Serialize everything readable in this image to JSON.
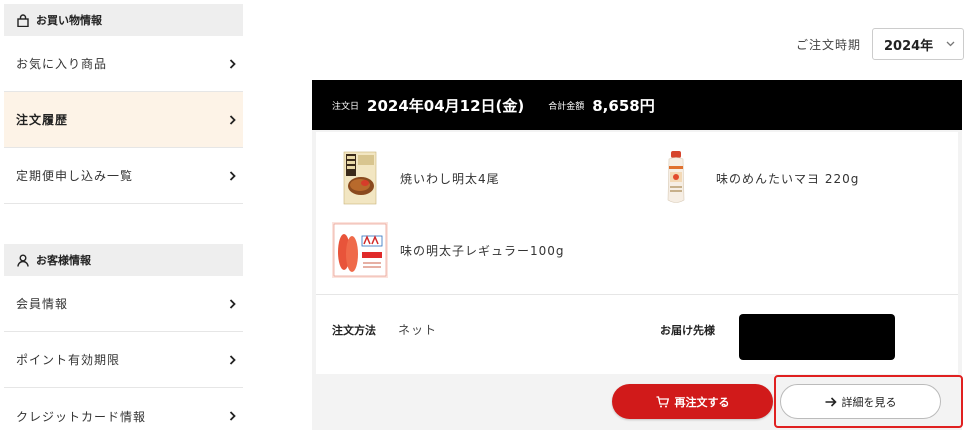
{
  "sidebar": {
    "shopping_section": {
      "icon": "shopping-bag-icon",
      "title": "お買い物情報",
      "items": [
        {
          "label": "お気に入り商品",
          "active": false
        },
        {
          "label": "注文履歴",
          "active": true
        },
        {
          "label": "定期便申し込み一覧",
          "active": false
        }
      ]
    },
    "customer_section": {
      "icon": "user-icon",
      "title": "お客様情報",
      "items": [
        {
          "label": "会員情報",
          "active": false
        },
        {
          "label": "ポイント有効期限",
          "active": false
        },
        {
          "label": "クレジットカード情報",
          "active": false
        }
      ]
    }
  },
  "filter": {
    "label": "ご注文時期",
    "selected": "2024年"
  },
  "order": {
    "date_label": "注文日",
    "date": "2024年04月12日(金)",
    "total_label": "合計金額",
    "total": "8,658円",
    "items": [
      {
        "name": "焼いわし明太4尾",
        "thumb": "grilled-sardine-package-thumb"
      },
      {
        "name": "味のめんたいマヨ 220g",
        "thumb": "mentai-mayo-bottle-thumb"
      },
      {
        "name": "味の明太子レギュラー100g",
        "thumb": "mentaiko-regular-package-thumb"
      }
    ],
    "method_label": "注文方法",
    "method": "ネット",
    "recipient_label": "お届け先様",
    "recipient_redacted": true
  },
  "actions": {
    "reorder_label": "再注文する",
    "reorder_icon": "cart-icon",
    "detail_label": "詳細を見る",
    "detail_icon": "arrow-right-icon",
    "highlight_color": "#e02020"
  },
  "colors": {
    "accent_red": "#d11a1a",
    "active_item_bg": "#fdf3e7",
    "header_bg": "#000000"
  }
}
